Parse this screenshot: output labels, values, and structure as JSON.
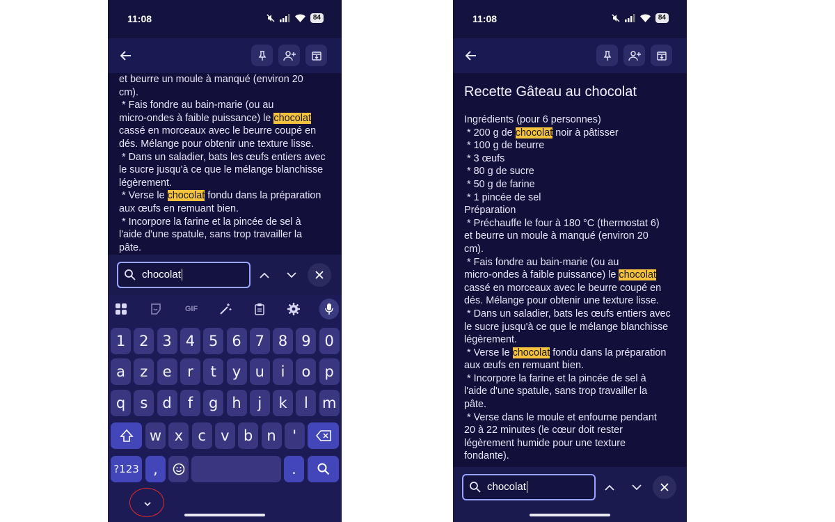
{
  "status": {
    "time": "11:08",
    "battery": "84"
  },
  "left": {
    "note_lines": [
      [
        {
          "t": "et beurre un moule à manqué (environ 20"
        }
      ],
      [
        {
          "t": "cm)."
        }
      ],
      [
        {
          "t": " * Fais fondre au bain-marie (ou au"
        }
      ],
      [
        {
          "t": "micro-ondes à faible puissance) le "
        },
        {
          "t": "chocolat",
          "h": true
        }
      ],
      [
        {
          "t": "cassé en morceaux avec le beurre coupé en"
        }
      ],
      [
        {
          "t": "dés. Mélange pour obtenir une texture lisse."
        }
      ],
      [
        {
          "t": " * Dans un saladier, bats les œufs entiers avec"
        }
      ],
      [
        {
          "t": "le sucre jusqu'à ce que le mélange blanchisse"
        }
      ],
      [
        {
          "t": "légèrement."
        }
      ],
      [
        {
          "t": " * Verse le "
        },
        {
          "t": "chocolat",
          "h": true
        },
        {
          "t": " fondu dans la préparation"
        }
      ],
      [
        {
          "t": "aux œufs en remuant bien."
        }
      ],
      [
        {
          "t": " * Incorpore la farine et la pincée de sel à"
        }
      ],
      [
        {
          "t": "l'aide d'une spatule, sans trop travailler la"
        }
      ],
      [
        {
          "t": "pâte."
        }
      ]
    ],
    "search_value": "chocolat"
  },
  "keyboard": {
    "tools": [
      "apps-grid-icon",
      "sticker-icon",
      "GIF",
      "magic-wand-icon",
      "clipboard-icon",
      "settings-gear-icon",
      "microphone-icon"
    ],
    "rows": [
      [
        "1",
        "2",
        "3",
        "4",
        "5",
        "6",
        "7",
        "8",
        "9",
        "0"
      ],
      [
        "a",
        "z",
        "e",
        "r",
        "t",
        "y",
        "u",
        "i",
        "o",
        "p"
      ],
      [
        "q",
        "s",
        "d",
        "f",
        "g",
        "h",
        "j",
        "k",
        "l",
        "m"
      ],
      [
        "w",
        "x",
        "c",
        "v",
        "b",
        "n",
        "'"
      ]
    ],
    "symbols_label": "?123",
    "comma": ",",
    "period": "."
  },
  "right": {
    "title": "Recette Gâteau au chocolat",
    "note_lines": [
      [
        {
          "t": "Ingrédients (pour 6 personnes)"
        }
      ],
      [
        {
          "t": " * 200 g de "
        },
        {
          "t": "chocolat",
          "h": true
        },
        {
          "t": " noir à pâtisser"
        }
      ],
      [
        {
          "t": " * 100 g de beurre"
        }
      ],
      [
        {
          "t": " * 3 œufs"
        }
      ],
      [
        {
          "t": " * 80 g de sucre"
        }
      ],
      [
        {
          "t": " * 50 g de farine"
        }
      ],
      [
        {
          "t": " * 1 pincée de sel"
        }
      ],
      [
        {
          "t": "Préparation"
        }
      ],
      [
        {
          "t": " * Préchauffe le four à 180 °C (thermostat 6)"
        }
      ],
      [
        {
          "t": "et beurre un moule à manqué (environ 20"
        }
      ],
      [
        {
          "t": "cm)."
        }
      ],
      [
        {
          "t": " * Fais fondre au bain-marie (ou au"
        }
      ],
      [
        {
          "t": "micro-ondes à faible puissance) le "
        },
        {
          "t": "chocolat",
          "h": true
        }
      ],
      [
        {
          "t": "cassé en morceaux avec le beurre coupé en"
        }
      ],
      [
        {
          "t": "dés. Mélange pour obtenir une texture lisse."
        }
      ],
      [
        {
          "t": " * Dans un saladier, bats les œufs entiers avec"
        }
      ],
      [
        {
          "t": "le sucre jusqu'à ce que le mélange blanchisse"
        }
      ],
      [
        {
          "t": "légèrement."
        }
      ],
      [
        {
          "t": " * Verse le "
        },
        {
          "t": "chocolat",
          "h": true
        },
        {
          "t": " fondu dans la préparation"
        }
      ],
      [
        {
          "t": "aux œufs en remuant bien."
        }
      ],
      [
        {
          "t": " * Incorpore la farine et la pincée de sel à"
        }
      ],
      [
        {
          "t": "l'aide d'une spatule, sans trop travailler la"
        }
      ],
      [
        {
          "t": "pâte."
        }
      ],
      [
        {
          "t": " * Verse dans le moule et enfourne pendant"
        }
      ],
      [
        {
          "t": "20 à 22 minutes (le cœur doit rester"
        }
      ],
      [
        {
          "t": "légèrement humide pour une texture"
        }
      ],
      [
        {
          "t": "fondante)."
        }
      ]
    ],
    "search_value": "chocolat"
  },
  "colors": {
    "highlight": "#f5c23e",
    "background": "#12103a",
    "annotation": "#e22a2a"
  }
}
